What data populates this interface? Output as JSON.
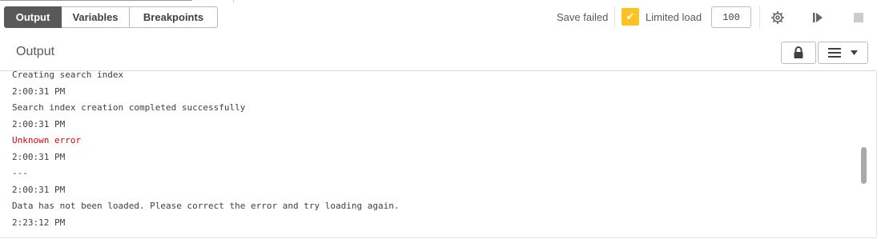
{
  "tabs": [
    {
      "label": "Output",
      "active": true
    },
    {
      "label": "Variables",
      "active": false
    },
    {
      "label": "Breakpoints",
      "active": false
    }
  ],
  "toolbar": {
    "save_status": "Save failed",
    "limited_load_label": "Limited load",
    "limited_load_checked": true,
    "limit_value": "100",
    "accent_color": "#ffc223"
  },
  "icons": {
    "settings": "gear-icon",
    "debug": "step-forward-icon",
    "stop": "stop-icon",
    "lock": "lock-icon",
    "menu": "hamburger-menu-icon",
    "dropdown": "caret-down-icon"
  },
  "panel": {
    "title": "Output"
  },
  "log": [
    {
      "text": "Creating search index",
      "type": "message"
    },
    {
      "text": "2:00:31 PM",
      "type": "timestamp"
    },
    {
      "text": "Search index creation completed successfully",
      "type": "message"
    },
    {
      "text": "2:00:31 PM",
      "type": "timestamp"
    },
    {
      "text": "Unknown error",
      "type": "error"
    },
    {
      "text": "2:00:31 PM",
      "type": "timestamp"
    },
    {
      "text": "---",
      "type": "message"
    },
    {
      "text": "2:00:31 PM",
      "type": "timestamp"
    },
    {
      "text": "Data has not been loaded. Please correct the error and try loading again.",
      "type": "message"
    },
    {
      "text": "2:23:12 PM",
      "type": "timestamp"
    }
  ],
  "colors": {
    "error_text": "#e00000",
    "active_tab": "#595959"
  }
}
